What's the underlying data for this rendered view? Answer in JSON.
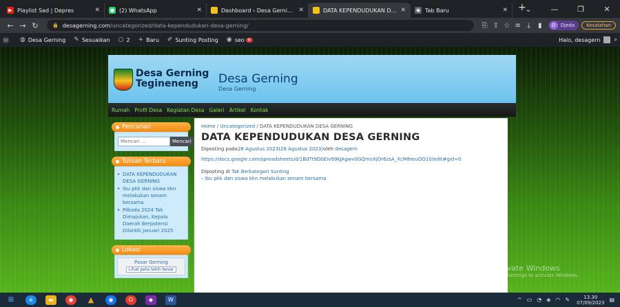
{
  "browser": {
    "tabs": [
      {
        "label": "Playlist Sad | Depres",
        "fav_color": "#e62117",
        "active": false
      },
      {
        "label": "(2) WhatsApp",
        "fav_color": "#25d366",
        "active": false
      },
      {
        "label": "Dashboard ‹ Desa Gerning — ",
        "fav_color": "#f2c21c",
        "active": false
      },
      {
        "label": "DATA KEPENDUDUKAN DES/",
        "fav_color": "#f2c21c",
        "active": true
      },
      {
        "label": "Tab Baru",
        "fav_color": "#5f6368",
        "active": false
      }
    ],
    "address": {
      "host": "desagerning.com",
      "path": "/uncategorized/data-kependudukan-desa-gerning/"
    },
    "profile_name": "Djeda",
    "error_label": "Kesalahan"
  },
  "adminbar": {
    "site_name": "Desa Gerning",
    "customize": "Sesuaikan",
    "comments_count": "2",
    "new_label": "Baru",
    "edit_post": "Sunting Posting",
    "seo": "seo",
    "seo_badge": "9",
    "greeting": "Halo, desagern"
  },
  "site": {
    "logo_line1": "Desa Gerning",
    "logo_line2": "Tegineneng",
    "title": "Desa Gerning",
    "description": "Desa Gerning",
    "nav": [
      "Rumah",
      "Profil Desa",
      "Kegiatan Desa",
      "Galeri",
      "Artikel",
      "Kontak"
    ]
  },
  "sidebar": {
    "search_title": "Pencarian",
    "search_placeholder": "Mencari ...",
    "search_button": "Mencari",
    "recent_title": "Tulisan Terbaru",
    "recent_posts": [
      "DATA KEPENDUDUKAN DESA GERNING",
      "Ibu pkk dan siswa kkn melakukan senam bersama",
      "Pilkada 2024 Tak Dimajukan, Kepala Daerah Berpotensi Dilantik Januari 2025"
    ],
    "location_title": "Lokasi",
    "map_label": "Pasar Gerning",
    "map_link": "Lihat peta lebih besar"
  },
  "post": {
    "breadcrumb_home": "Home",
    "breadcrumb_cat": "Uncategorized",
    "breadcrumb_current": "DATA KEPENDUDUKAN DESA GERNING",
    "title": "DATA KEPENDUDUKAN DESA GERNING",
    "meta_prefix": "Diposting pada",
    "meta_date": "28 Agustus 2023",
    "meta_updated": "(28 Agustus 2023)",
    "meta_by": "oleh",
    "meta_author": "desagern",
    "link": "https://docs.google.com/spreadsheets/d/1BdTt9DbEIv99kJAgwv0GQmoXjOr6zsA_XcM8reuOO10/edit#gid=0",
    "cat_prefix": "Diposting di",
    "category": "Tak Berkategori",
    "edit": "Sunting",
    "prev_post": "‹ Ibu pkk dan siswa kkn melakukan senam bersama"
  },
  "watermark": {
    "line1": "Activate Windows",
    "line2": "Go to Settings to activate Windows."
  },
  "taskbar": {
    "time": "13.30",
    "date": "07/09/2023"
  }
}
